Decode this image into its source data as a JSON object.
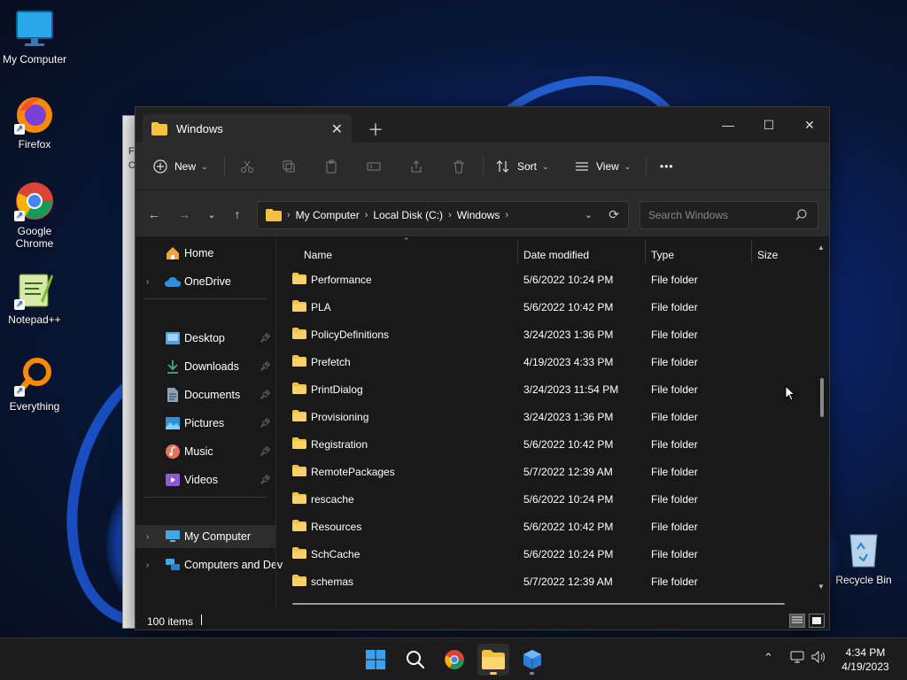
{
  "desktop": {
    "icons": [
      {
        "label": "My Computer"
      },
      {
        "label": "Firefox"
      },
      {
        "label": "Google Chrome"
      },
      {
        "label": "Notepad++"
      },
      {
        "label": "Everything"
      },
      {
        "label": "Recycle Bin"
      }
    ],
    "background_window_letters": [
      "F",
      "C"
    ]
  },
  "explorer": {
    "tab": {
      "title": "Windows"
    },
    "toolbar": {
      "new_label": "New",
      "sort_label": "Sort",
      "view_label": "View",
      "more_label": "•••"
    },
    "address": {
      "crumbs": [
        "My Computer",
        "Local Disk (C:)",
        "Windows"
      ]
    },
    "search": {
      "placeholder": "Search Windows"
    },
    "sidebar": {
      "home": "Home",
      "onedrive": "OneDrive",
      "quick": [
        {
          "label": "Desktop"
        },
        {
          "label": "Downloads"
        },
        {
          "label": "Documents"
        },
        {
          "label": "Pictures"
        },
        {
          "label": "Music"
        },
        {
          "label": "Videos"
        }
      ],
      "my_computer": "My Computer",
      "network": "Computers and Dev"
    },
    "columns": {
      "name": "Name",
      "date": "Date modified",
      "type": "Type",
      "size": "Size"
    },
    "files": [
      {
        "name": "Performance",
        "date": "5/6/2022 10:24 PM",
        "type": "File folder"
      },
      {
        "name": "PLA",
        "date": "5/6/2022 10:42 PM",
        "type": "File folder"
      },
      {
        "name": "PolicyDefinitions",
        "date": "3/24/2023 1:36 PM",
        "type": "File folder"
      },
      {
        "name": "Prefetch",
        "date": "4/19/2023 4:33 PM",
        "type": "File folder"
      },
      {
        "name": "PrintDialog",
        "date": "3/24/2023 11:54 PM",
        "type": "File folder"
      },
      {
        "name": "Provisioning",
        "date": "3/24/2023 1:36 PM",
        "type": "File folder"
      },
      {
        "name": "Registration",
        "date": "5/6/2022 10:42 PM",
        "type": "File folder"
      },
      {
        "name": "RemotePackages",
        "date": "5/7/2022 12:39 AM",
        "type": "File folder"
      },
      {
        "name": "rescache",
        "date": "5/6/2022 10:24 PM",
        "type": "File folder"
      },
      {
        "name": "Resources",
        "date": "5/6/2022 10:42 PM",
        "type": "File folder"
      },
      {
        "name": "SchCache",
        "date": "5/6/2022 10:24 PM",
        "type": "File folder"
      },
      {
        "name": "schemas",
        "date": "5/7/2022 12:39 AM",
        "type": "File folder"
      }
    ],
    "status": {
      "item_count": "100 items"
    }
  },
  "taskbar": {
    "clock": {
      "time": "4:34 PM",
      "date": "4/19/2023"
    }
  },
  "colors": {
    "folder": "#f6c142",
    "accent": "#4cc2ff",
    "window_bg": "#191919",
    "toolbar_bg": "#2b2b2b"
  }
}
